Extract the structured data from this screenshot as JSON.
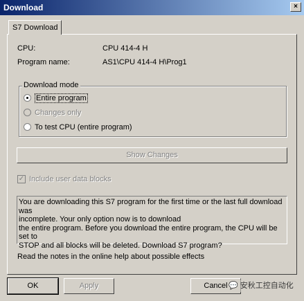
{
  "window": {
    "title": "Download",
    "close_glyph": "×"
  },
  "tab": {
    "label": "S7 Download"
  },
  "info": {
    "cpu_label": "CPU:",
    "cpu_value": "CPU 414-4 H",
    "program_label": "Program name:",
    "program_value": "AS1\\CPU 414-4 H\\Prog1"
  },
  "download_mode": {
    "title": "Download mode",
    "options": [
      {
        "label": "Entire program",
        "selected": true,
        "enabled": true
      },
      {
        "label": "Changes only",
        "selected": false,
        "enabled": false
      },
      {
        "label": "To test CPU (entire program)",
        "selected": false,
        "enabled": true
      }
    ]
  },
  "show_changes_label": "Show Changes",
  "include_user_data": {
    "label": "Include user data blocks",
    "checked": true,
    "enabled": false
  },
  "message": "You are downloading this S7 program for the first time or the last full download was\nincomplete. Your only option now is to download\nthe entire program. Before you download the entire program, the CPU will be set to\nSTOP and all blocks will be deleted. Download S7 program?",
  "note": "Read the notes in the online help about possible effects",
  "buttons": {
    "ok": "OK",
    "apply": "Apply",
    "cancel": "Cancel"
  },
  "watermark": "安秋工控自动化"
}
